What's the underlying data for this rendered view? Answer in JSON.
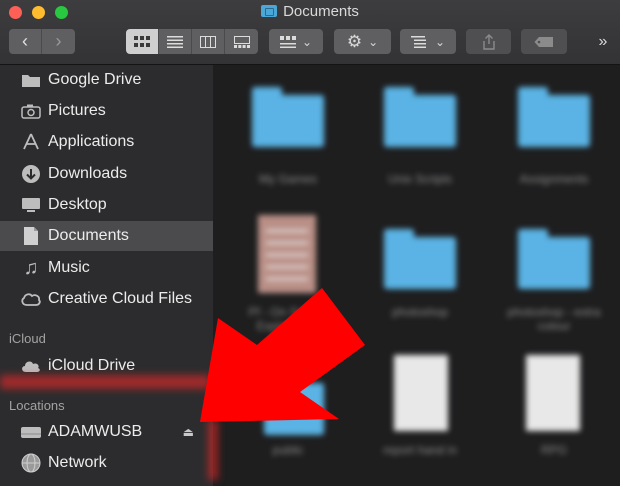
{
  "window": {
    "title": "Documents"
  },
  "toolbar": {
    "back_icon": "chevron-left-icon",
    "forward_icon": "chevron-right-icon",
    "view_modes": [
      "icon-view-icon",
      "list-view-icon",
      "column-view-icon",
      "gallery-view-icon"
    ],
    "group_icon": "group-grid-icon",
    "action_icon": "gear-icon",
    "arrange_icon": "sort-lines-icon",
    "share_icon": "share-icon",
    "tag_icon": "tag-icon",
    "overflow": "»"
  },
  "sidebar": {
    "favorites": [
      {
        "label": "Google Drive",
        "icon": "folder-icon"
      },
      {
        "label": "Pictures",
        "icon": "camera-icon"
      },
      {
        "label": "Applications",
        "icon": "applications-icon"
      },
      {
        "label": "Downloads",
        "icon": "download-icon"
      },
      {
        "label": "Desktop",
        "icon": "desktop-icon"
      },
      {
        "label": "Documents",
        "icon": "document-icon",
        "selected": true
      },
      {
        "label": "Music",
        "icon": "music-note-icon"
      },
      {
        "label": "Creative Cloud Files",
        "icon": "creative-cloud-icon"
      }
    ],
    "icloud_header": "iCloud",
    "icloud": [
      {
        "label": "iCloud Drive",
        "icon": "cloud-icon"
      }
    ],
    "locations_header": "Locations",
    "locations": [
      {
        "label": "ADAMWUSB",
        "icon": "drive-icon",
        "eject": "⏏"
      },
      {
        "label": "Network",
        "icon": "network-globe-icon"
      }
    ]
  },
  "files": [
    {
      "name": "My Games",
      "kind": "folder"
    },
    {
      "name": "Unix Scripts",
      "kind": "folder"
    },
    {
      "name": "Assignments",
      "kind": "folder"
    },
    {
      "name": "Pf - On Screen Explanation",
      "kind": "image"
    },
    {
      "name": "photoshop",
      "kind": "folder"
    },
    {
      "name": "photoshop - extra colour",
      "kind": "folder"
    },
    {
      "name": "public",
      "kind": "folder"
    },
    {
      "name": "report hand in",
      "kind": "document"
    },
    {
      "name": "RPG",
      "kind": "document"
    }
  ],
  "colors": {
    "arrow": "#ff0000",
    "folder": "#5ab3e4",
    "sidebar_bg": "#2c2c2e",
    "main_bg": "#1e1e1f"
  }
}
